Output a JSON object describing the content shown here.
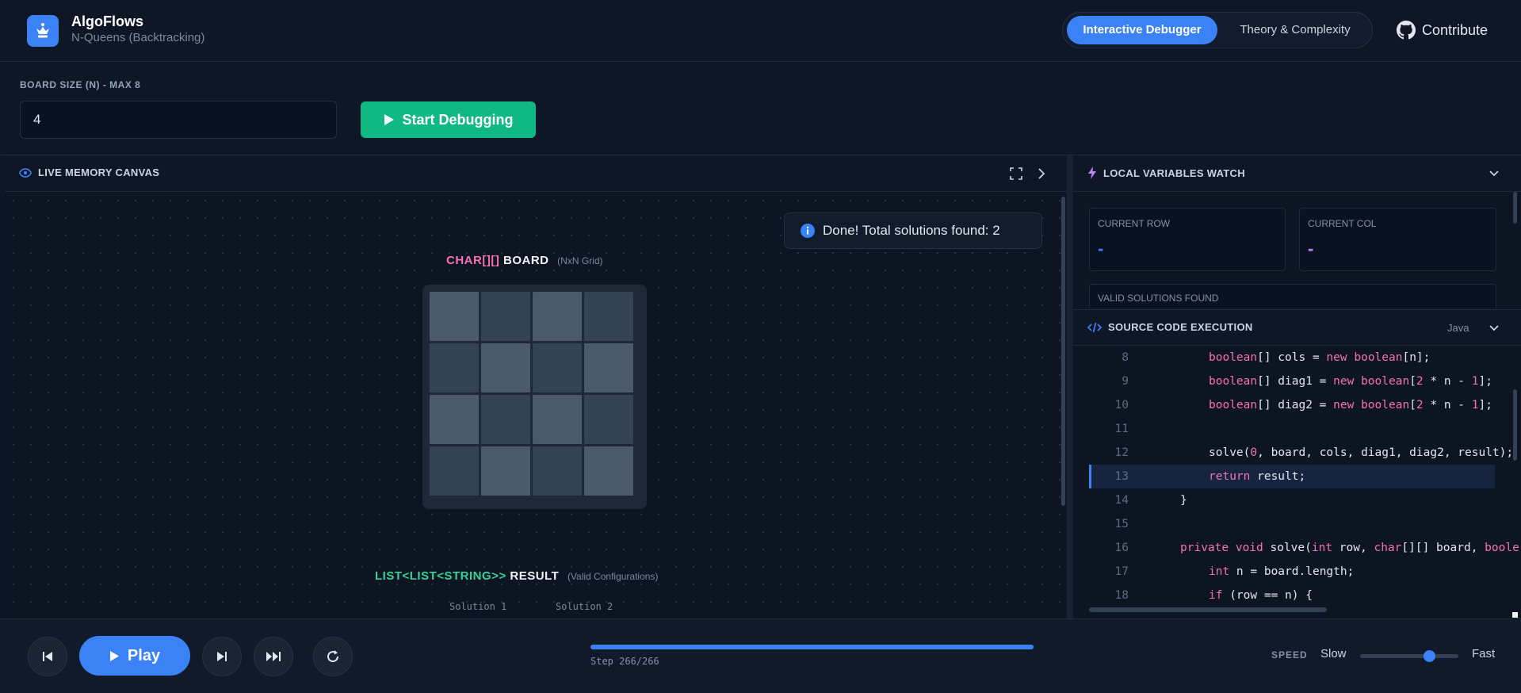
{
  "app": {
    "title": "AlgoFlows",
    "subtitle": "N-Queens (Backtracking)",
    "logo_icon": "chess-queen-icon",
    "accent": "#3b82f6"
  },
  "tabs": [
    {
      "label": "Interactive Debugger",
      "active": true
    },
    {
      "label": "Theory & Complexity",
      "active": false
    }
  ],
  "contribute": {
    "label": "Contribute",
    "icon": "github-icon"
  },
  "config": {
    "board_size_label": "BOARD SIZE (N) - MAX 8",
    "board_size_value": "4",
    "start_button": "Start Debugging",
    "start_color": "#10b981"
  },
  "canvas": {
    "title": "LIVE MEMORY CANVAS",
    "toast": "Done! Total solutions found: 2",
    "board_type": "CHAR[][]",
    "board_name": "BOARD",
    "board_hint": "(NxN Grid)",
    "board_cells": [
      [
        "light",
        "dark",
        "light",
        "dark"
      ],
      [
        "dark",
        "light",
        "dark",
        "light"
      ],
      [
        "light",
        "dark",
        "light",
        "dark"
      ],
      [
        "dark",
        "light",
        "dark",
        "light"
      ]
    ],
    "result_type": "LIST<LIST<STRING>>",
    "result_name": "RESULT",
    "result_hint": "(Valid Configurations)",
    "solutions": [
      "Solution 1",
      "Solution 2"
    ]
  },
  "variables": {
    "title": "LOCAL VARIABLES WATCH",
    "current_row_label": "CURRENT ROW",
    "current_row_value": "-",
    "current_col_label": "CURRENT COL",
    "current_col_value": "-",
    "valid_solutions_label": "VALID SOLUTIONS FOUND"
  },
  "code": {
    "title": "SOURCE CODE EXECUTION",
    "language": "Java",
    "active_line": 13,
    "lines": [
      {
        "n": "8",
        "indent": 2,
        "tokens": [
          [
            "kw",
            "boolean"
          ],
          [
            "t",
            "[] cols = "
          ],
          [
            "kw",
            "new"
          ],
          [
            "t",
            " "
          ],
          [
            "kw",
            "boolean"
          ],
          [
            "t",
            "[n];"
          ]
        ]
      },
      {
        "n": "9",
        "indent": 2,
        "tokens": [
          [
            "kw",
            "boolean"
          ],
          [
            "t",
            "[] diag1 = "
          ],
          [
            "kw",
            "new"
          ],
          [
            "t",
            " "
          ],
          [
            "kw",
            "boolean"
          ],
          [
            "t",
            "["
          ],
          [
            "num",
            "2"
          ],
          [
            "t",
            " * n - "
          ],
          [
            "num",
            "1"
          ],
          [
            "t",
            "];"
          ]
        ]
      },
      {
        "n": "10",
        "indent": 2,
        "tokens": [
          [
            "kw",
            "boolean"
          ],
          [
            "t",
            "[] diag2 = "
          ],
          [
            "kw",
            "new"
          ],
          [
            "t",
            " "
          ],
          [
            "kw",
            "boolean"
          ],
          [
            "t",
            "["
          ],
          [
            "num",
            "2"
          ],
          [
            "t",
            " * n - "
          ],
          [
            "num",
            "1"
          ],
          [
            "t",
            "];"
          ]
        ]
      },
      {
        "n": "11",
        "indent": 2,
        "tokens": []
      },
      {
        "n": "12",
        "indent": 2,
        "tokens": [
          [
            "t",
            "solve("
          ],
          [
            "num",
            "0"
          ],
          [
            "t",
            ", board, cols, diag1, diag2, result);"
          ]
        ]
      },
      {
        "n": "13",
        "indent": 2,
        "tokens": [
          [
            "kw",
            "return"
          ],
          [
            "t",
            " result;"
          ]
        ]
      },
      {
        "n": "14",
        "indent": 1,
        "tokens": [
          [
            "t",
            "}"
          ]
        ]
      },
      {
        "n": "15",
        "indent": 1,
        "tokens": []
      },
      {
        "n": "16",
        "indent": 1,
        "tokens": [
          [
            "kw",
            "private"
          ],
          [
            "t",
            " "
          ],
          [
            "kw",
            "void"
          ],
          [
            "t",
            " solve("
          ],
          [
            "kw",
            "int"
          ],
          [
            "t",
            " row, "
          ],
          [
            "kw",
            "char"
          ],
          [
            "t",
            "[][] board, "
          ],
          [
            "kw",
            "boole"
          ]
        ]
      },
      {
        "n": "17",
        "indent": 2,
        "tokens": [
          [
            "kw",
            "int"
          ],
          [
            "t",
            " n = board.length;"
          ]
        ]
      },
      {
        "n": "18",
        "indent": 2,
        "tokens": [
          [
            "kw",
            "if"
          ],
          [
            "t",
            " (row == n) {"
          ]
        ]
      }
    ]
  },
  "player": {
    "play_label": "Play",
    "step_text": "Step 266/266",
    "progress": 1.0,
    "speed_label": "SPEED",
    "speed_slow": "Slow",
    "speed_fast": "Fast",
    "speed_value": 0.7
  }
}
